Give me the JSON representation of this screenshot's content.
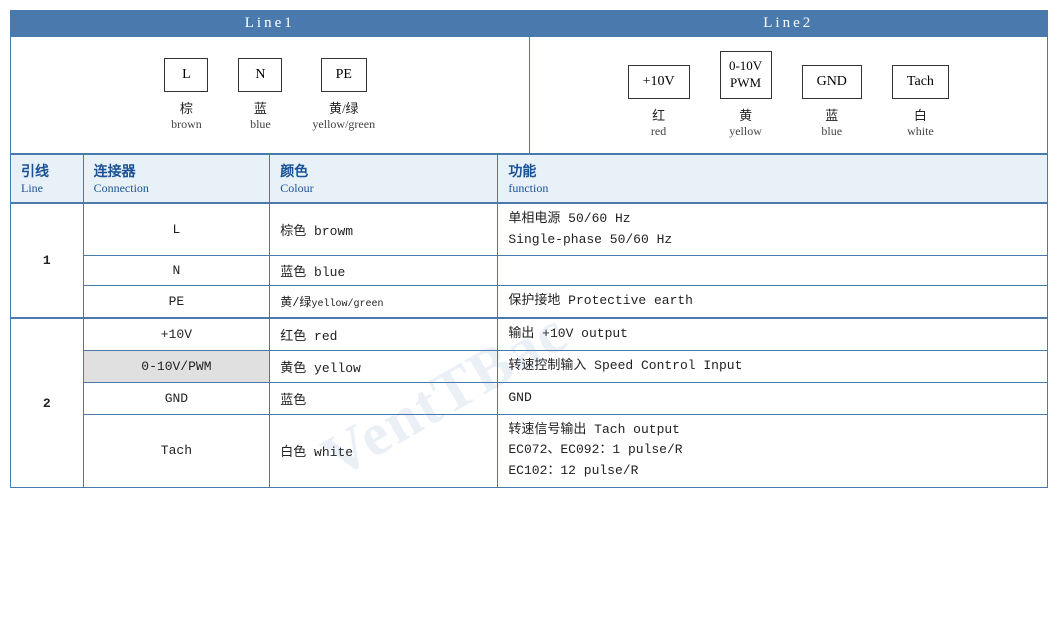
{
  "header": {
    "line1": "Line1",
    "line2": "Line2"
  },
  "diagram": {
    "line1": [
      {
        "symbol": "L",
        "zh": "棕",
        "en": "brown"
      },
      {
        "symbol": "N",
        "zh": "蓝",
        "en": "blue"
      },
      {
        "symbol": "PE",
        "zh": "黄/绿",
        "en": "yellow/green"
      }
    ],
    "line2": [
      {
        "symbol": "+10V",
        "zh": "红",
        "en": "red"
      },
      {
        "symbol": "0-10V\nPWM",
        "zh": "黄",
        "en": "yellow"
      },
      {
        "symbol": "GND",
        "zh": "蓝",
        "en": "blue"
      },
      {
        "symbol": "Tach",
        "zh": "白",
        "en": "white"
      }
    ]
  },
  "table": {
    "headers": {
      "line": {
        "zh": "引线",
        "en": "Line"
      },
      "connection": {
        "zh": "连接器",
        "en": "Connection"
      },
      "colour": {
        "zh": "颜色",
        "en": "Colour"
      },
      "function": {
        "zh": "功能",
        "en": "function"
      }
    },
    "rows": [
      {
        "line": "1",
        "connections": [
          {
            "conn": "L",
            "colour": "棕色 browm",
            "function": "单相电源 50/60 Hz\nSingle-phase 50/60 Hz",
            "grey": false
          },
          {
            "conn": "N",
            "colour": "蓝色 blue",
            "function": "",
            "grey": false
          },
          {
            "conn": "PE",
            "colour": "黄/绿 yellow/green",
            "function": "保护接地 Protective earth",
            "grey": false
          }
        ]
      },
      {
        "line": "2",
        "connections": [
          {
            "conn": "+10V",
            "colour": "红色 red",
            "function": "输出 +10V output",
            "grey": false
          },
          {
            "conn": "0-10V/PWM",
            "colour": "黄色 yellow",
            "function": "转速控制输入 Speed Control Input",
            "grey": true
          },
          {
            "conn": "GND",
            "colour": "蓝色",
            "function": "GND",
            "grey": false
          },
          {
            "conn": "Tach",
            "colour": "白色 white",
            "function": "转速信号输出 Tach output\nEC072、EC092：1 pulse/R\nEC102：12 pulse/R",
            "grey": false
          }
        ]
      }
    ]
  },
  "watermark": "VentTBac"
}
